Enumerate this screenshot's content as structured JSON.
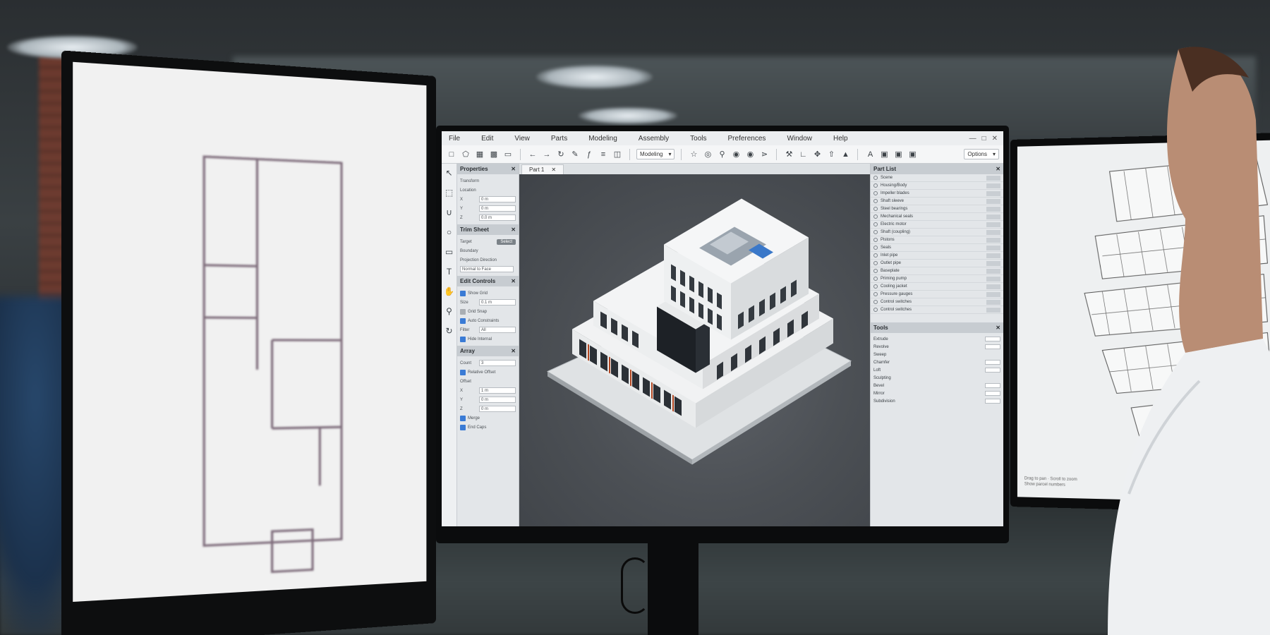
{
  "app": {
    "menu": [
      "File",
      "Edit",
      "View",
      "Parts",
      "Modeling",
      "Assembly",
      "Tools",
      "Preferences",
      "Window",
      "Help"
    ],
    "toolbar": {
      "mode_select": "Modeling",
      "right_select": "Options"
    },
    "viewport_tab": "Part 1",
    "panels": {
      "properties": {
        "title": "Properties",
        "subsection": "Transform",
        "location_label": "Location",
        "rows": [
          {
            "axis": "X",
            "value": "0 m"
          },
          {
            "axis": "Y",
            "value": "0 m"
          },
          {
            "axis": "Z",
            "value": "0.0 m"
          }
        ]
      },
      "trim_sheet": {
        "title": "Trim Sheet",
        "target_label": "Target",
        "select_button": "Select",
        "boundary_label": "Boundary",
        "projection_label": "Projection Direction",
        "projection_value": "Normal to Face"
      },
      "edit_controls": {
        "title": "Edit Controls",
        "show_grid": "Show Grid",
        "size_label": "Size",
        "size_value": "0.1 m",
        "grid_snap": "Grid Snap",
        "auto_constraints": "Auto Constraints",
        "filter_label": "Filter",
        "filter_value": "All",
        "hide_internal": "Hide Internal"
      },
      "array": {
        "title": "Array",
        "count_label": "Count",
        "count_value": "3",
        "relative_offset": "Relative Offset",
        "offset_label": "Offset",
        "offset_rows": [
          {
            "axis": "X",
            "value": "1 m"
          },
          {
            "axis": "Y",
            "value": "0 m"
          },
          {
            "axis": "Z",
            "value": "0 m"
          }
        ],
        "merge": "Merge",
        "end_caps": "End Caps"
      }
    },
    "part_list": {
      "title": "Part List",
      "items": [
        "Scene",
        "Housing/Body",
        "Impeller blades",
        "Shaft sleeve",
        "Steel bearings",
        "Mechanical seals",
        "Electric motor",
        "Shaft (coupling)",
        "Pistons",
        "Seals",
        "Inlet pipe",
        "Outlet pipe",
        "Baseplate",
        "Priming pump",
        "Cooling jacket",
        "Pressure gauges",
        "Control switches",
        "Control switches"
      ]
    },
    "tools": {
      "title": "Tools",
      "items": [
        "Extrude",
        "Revolve",
        "Sweep",
        "Chamfer",
        "Loft",
        "Sculpting",
        "Bevel",
        "Mirror",
        "Subdivision"
      ]
    }
  },
  "right_screen": {
    "caption_lines": [
      "Drag to pan · Scroll to zoom",
      "Show parcel numbers"
    ]
  }
}
